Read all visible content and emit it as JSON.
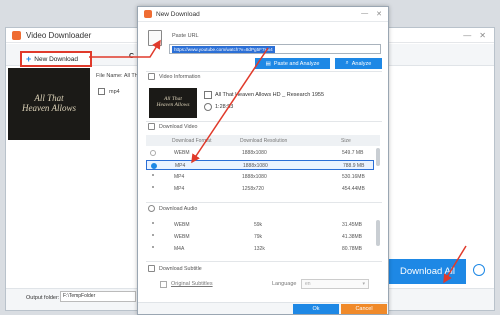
{
  "app": {
    "title": "Video Downloader",
    "new_download_label": "New Download",
    "toolbar_cut_label": "C",
    "file_name_label": "File Name: All That",
    "format_value": "mp4",
    "thumb_line1": "All That",
    "thumb_line2": "Heaven Allows",
    "output_label": "Output folder:",
    "output_value": "F:\\TempFolder",
    "download_all_label": "Download All"
  },
  "dialog": {
    "title": "New Download",
    "paste_url_label": "Paste URL",
    "url_value": "https://www.youtube.com/watch?v=8dPg5F7Hx4",
    "paste_analyze_label": "Paste and Analyze",
    "analyze_label": "Analyze",
    "video_info_label": "Video Information",
    "video_title": "All That Heaven Allows HD _ Research 1955",
    "duration": "1:28:53",
    "thumb_line1": "All That",
    "thumb_line2": "Heaven Allows",
    "download_video_label": "Download Video",
    "video_columns": [
      "Download Format",
      "Download Resolution",
      "Size"
    ],
    "video_rows": [
      {
        "format": "WEBM",
        "resolution": "1888x1080",
        "size": "549.7 MB"
      },
      {
        "format": "MP4",
        "resolution": "1888x1080",
        "size": "788.9 MB"
      },
      {
        "format": "MP4",
        "resolution": "1888x1080",
        "size": "530.16MB"
      },
      {
        "format": "MP4",
        "resolution": "1258x720",
        "size": "454.44MB"
      }
    ],
    "download_audio_label": "Download Audio",
    "audio_rows": [
      {
        "format": "WEBM",
        "bitrate": "59k",
        "size": "31.45MB"
      },
      {
        "format": "WEBM",
        "bitrate": "79k",
        "size": "41.38MB"
      },
      {
        "format": "M4A",
        "bitrate": "132k",
        "size": "80.78MB"
      }
    ],
    "download_subtitle_label": "Download Subtitle",
    "original_subtitles_label": "Original Subtitles",
    "language_label": "Language",
    "language_value": "en",
    "ok_label": "Ok",
    "cancel_label": "Cancel"
  },
  "colors": {
    "accent": "#1e88e5",
    "highlight": "#e03a2b",
    "cancel": "#f08a2a"
  }
}
